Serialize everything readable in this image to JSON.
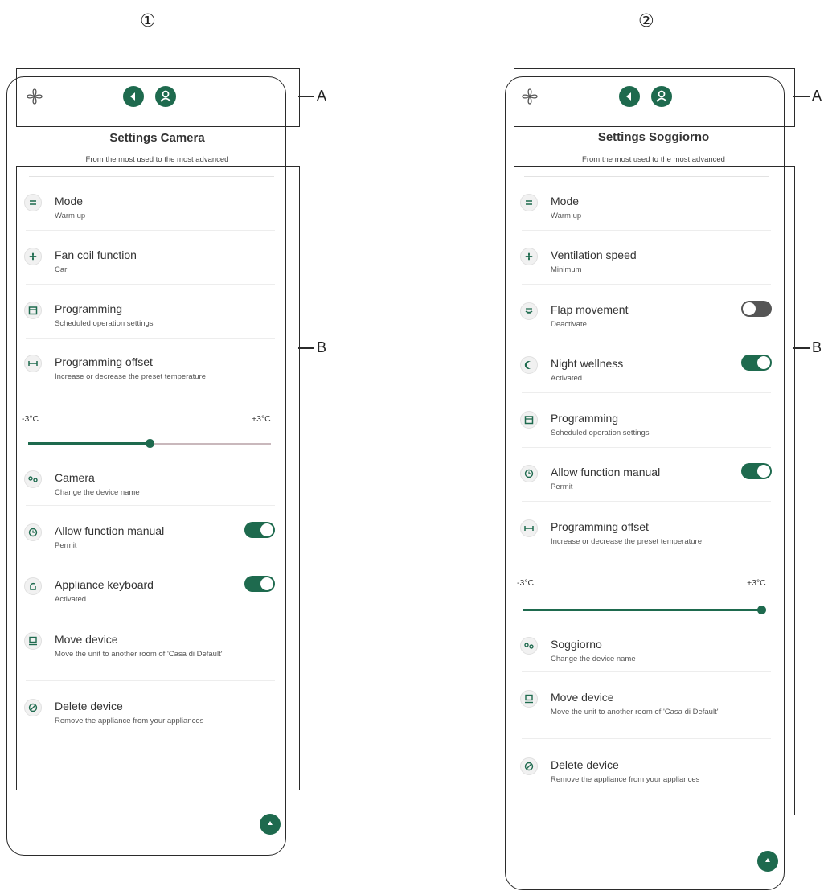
{
  "screens": [
    {
      "number": "①",
      "title": "Settings Camera",
      "subtitle": "From the most used to the most advanced",
      "callout_a": "A",
      "callout_b": "B",
      "items": [
        {
          "label": "Mode",
          "sub": "Warm up",
          "icon": "mode-icon"
        },
        {
          "label": "Fan coil function",
          "sub": "Car",
          "icon": "fan-icon"
        },
        {
          "label": "Programming",
          "sub": "Scheduled operation settings",
          "icon": "calendar-icon"
        },
        {
          "label": "Programming offset",
          "sub": "Increase or decrease the preset temperature",
          "icon": "offset-icon"
        },
        {
          "label": "Camera",
          "sub": "Change the device name",
          "icon": "rename-icon"
        },
        {
          "label": "Allow function manual",
          "sub": "Permit",
          "icon": "manual-icon",
          "toggle": "on"
        },
        {
          "label": "Appliance keyboard",
          "sub": "Activated",
          "icon": "keyboard-icon",
          "toggle": "on"
        },
        {
          "label": "Move device",
          "sub": "Move the unit to another room of 'Casa di Default'",
          "icon": "move-icon"
        },
        {
          "label": "Delete device",
          "sub": "Remove the appliance from your appliances",
          "icon": "delete-icon"
        }
      ],
      "slider": {
        "min_label": "-3°C",
        "max_label": "+3°C",
        "min": -3,
        "max": 3,
        "value": 0
      }
    },
    {
      "number": "②",
      "title": "Settings Soggiorno",
      "subtitle": "From the most used to the most advanced",
      "callout_a": "A",
      "callout_b": "B",
      "items": [
        {
          "label": "Mode",
          "sub": "Warm up",
          "icon": "mode-icon"
        },
        {
          "label": "Ventilation speed",
          "sub": "Minimum",
          "icon": "fan-icon"
        },
        {
          "label": "Flap movement",
          "sub": "Deactivate",
          "icon": "flap-icon",
          "toggle": "off"
        },
        {
          "label": "Night wellness",
          "sub": "Activated",
          "icon": "moon-icon",
          "toggle": "on"
        },
        {
          "label": "Programming",
          "sub": "Scheduled operation settings",
          "icon": "calendar-icon"
        },
        {
          "label": "Allow function manual",
          "sub": "Permit",
          "icon": "manual-icon",
          "toggle": "on"
        },
        {
          "label": "Programming offset",
          "sub": "Increase or decrease the preset temperature",
          "icon": "offset-icon"
        },
        {
          "label": "Soggiorno",
          "sub": "Change the device name",
          "icon": "rename-icon"
        },
        {
          "label": "Move device",
          "sub": "Move the unit to another room of 'Casa di Default'",
          "icon": "move-icon"
        },
        {
          "label": "Delete device",
          "sub": "Remove the appliance from your appliances",
          "icon": "delete-icon"
        }
      ],
      "slider": {
        "min_label": "-3°C",
        "max_label": "+3°C",
        "min": -3,
        "max": 3,
        "value": 3
      }
    }
  ]
}
